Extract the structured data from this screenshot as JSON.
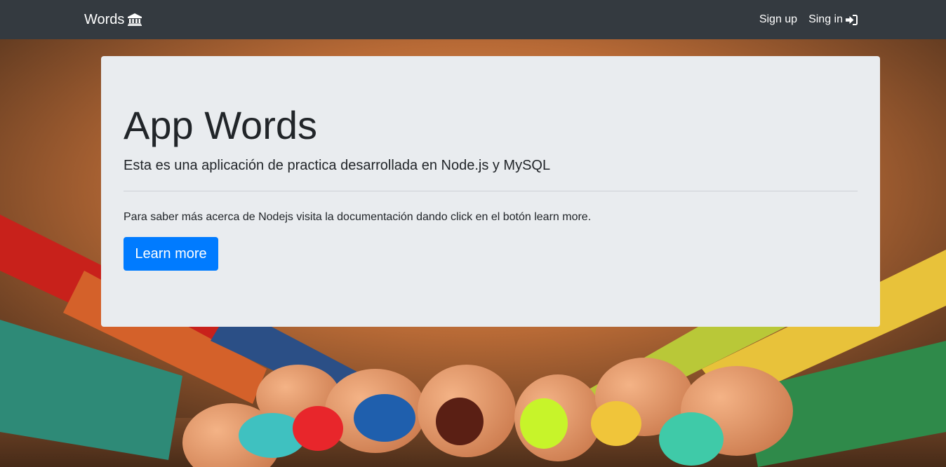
{
  "navbar": {
    "brand": "Words",
    "brand_icon": "bank-icon",
    "links": [
      {
        "label": "Sign up"
      },
      {
        "label": "Sing in",
        "icon": "sign-in-icon"
      }
    ]
  },
  "hero": {
    "title": "App Words",
    "lead": "Esta es una aplicación de practica desarrollada en Node.js y MySQL",
    "text": "Para saber más acerca de Nodejs visita la documentación dando click en el botón learn more.",
    "button_label": "Learn more"
  },
  "colors": {
    "navbar": "#343a40",
    "jumbotron": "#e9ecef",
    "primary": "#007bff"
  },
  "background": "colored-pencils-photo"
}
